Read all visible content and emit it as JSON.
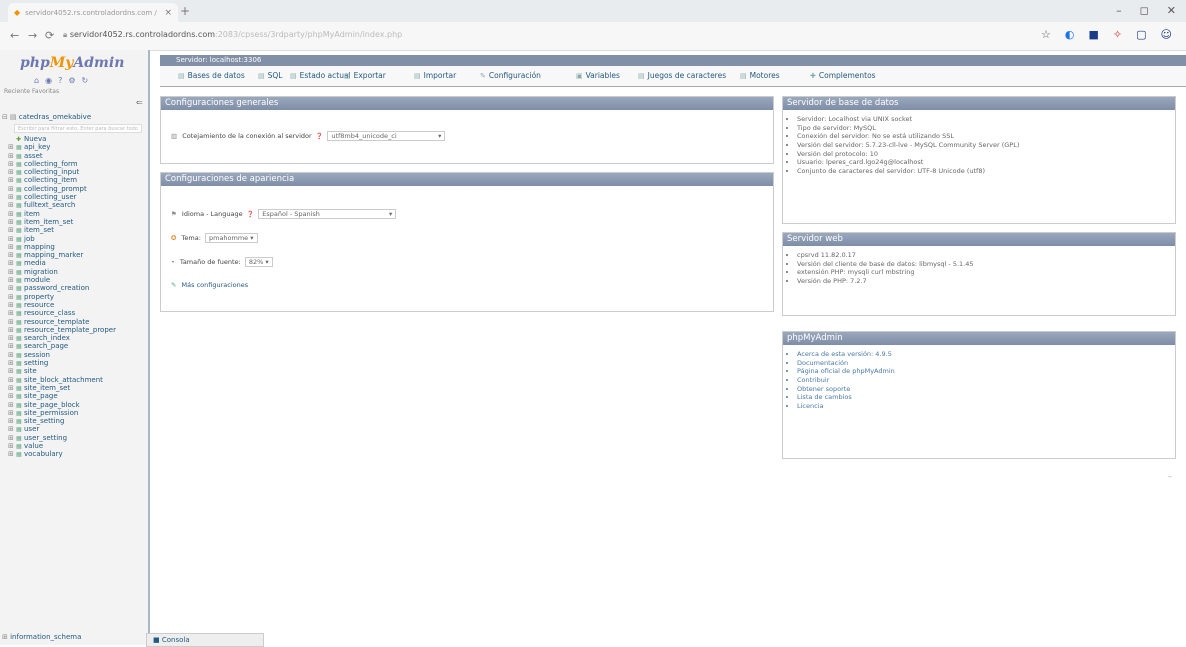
{
  "browser": {
    "tab_title": "servidor4052.rs.controladordns.com / ...",
    "new_tab": "+",
    "tab_close": "×",
    "url_host": "servidor4052.rs.controladordns.com",
    "url_rest": ":2083/cpsess/3rdparty/phpMyAdmin/index.php",
    "window_controls": [
      "–",
      "◻",
      "✕"
    ]
  },
  "sidebar": {
    "logo_php": "php",
    "logo_my": "My",
    "logo_admin": "Admin",
    "recent_favorites": "Reciente   Favoritas",
    "collapse": "⇐",
    "database": "catedras_omekabive",
    "filter_placeholder": "Escribir para filtrar esto, Enter para buscar todo",
    "new_label": "Nueva",
    "tables": [
      "api_key",
      "asset",
      "collecting_form",
      "collecting_input",
      "collecting_item",
      "collecting_prompt",
      "collecting_user",
      "fulltext_search",
      "item",
      "item_item_set",
      "item_set",
      "job",
      "mapping",
      "mapping_marker",
      "media",
      "migration",
      "module",
      "password_creation",
      "property",
      "resource",
      "resource_class",
      "resource_template",
      "resource_template_proper",
      "search_index",
      "search_page",
      "session",
      "setting",
      "site",
      "site_block_attachment",
      "site_item_set",
      "site_page",
      "site_page_block",
      "site_permission",
      "site_setting",
      "user",
      "user_setting",
      "value",
      "vocabulary"
    ],
    "info_schema": "information_schema"
  },
  "server_bar": {
    "label": "Servidor: localhost:3306"
  },
  "menu": [
    {
      "icon": "▤",
      "label": "Bases de datos"
    },
    {
      "icon": "▤",
      "label": "SQL"
    },
    {
      "icon": "▤",
      "label": "Estado actual"
    },
    {
      "icon": "▤",
      "label": "Exportar"
    },
    {
      "icon": "▤",
      "label": "Importar"
    },
    {
      "icon": "✎",
      "label": "Configuración"
    },
    {
      "icon": "▣",
      "label": "Variables"
    },
    {
      "icon": "▤",
      "label": "Juegos de caracteres"
    },
    {
      "icon": "▤",
      "label": "Motores"
    },
    {
      "icon": "✚",
      "label": "Complementos"
    }
  ],
  "general": {
    "title": "Configuraciones generales",
    "collation_label": "Cotejamiento de la conexión al servidor",
    "collation_value": "utf8mb4_unicode_ci"
  },
  "appearance": {
    "title": "Configuraciones de apariencia",
    "language_label": "Idioma - Language",
    "language_value": "Español - Spanish",
    "theme_label": "Tema:",
    "theme_value": "pmahomme",
    "fontsize_label": "Tamaño de fuente:",
    "fontsize_value": "82%",
    "more_settings": "Más configuraciones"
  },
  "dbserver": {
    "title": "Servidor de base de datos",
    "items": [
      "Servidor: Localhost via UNIX socket",
      "Tipo de servidor: MySQL",
      "Conexión del servidor: No se está utilizando SSL",
      "Versión del servidor: 5.7.23-cll-lve - MySQL Community Server (GPL)",
      "Versión del protocolo: 10",
      "Usuario: lperes_card.lgo24g@localhost",
      "Conjunto de caracteres del servidor: UTF-8 Unicode (utf8)"
    ]
  },
  "webserver": {
    "title": "Servidor web",
    "items": [
      "cpsrvd 11.82.0.17",
      "Versión del cliente de base de datos: libmysql - 5.1.45",
      "extensión PHP: mysqli  curl  mbstring",
      "Versión de PHP: 7.2.7"
    ]
  },
  "pma": {
    "title": "phpMyAdmin",
    "items": [
      "Acerca de esta versión: 4.9.5",
      "Documentación",
      "Página oficial de phpMyAdmin",
      "Contribuir",
      "Obtener soporte",
      "Lista de cambios",
      "Licencia"
    ]
  },
  "console_label": "Consola"
}
